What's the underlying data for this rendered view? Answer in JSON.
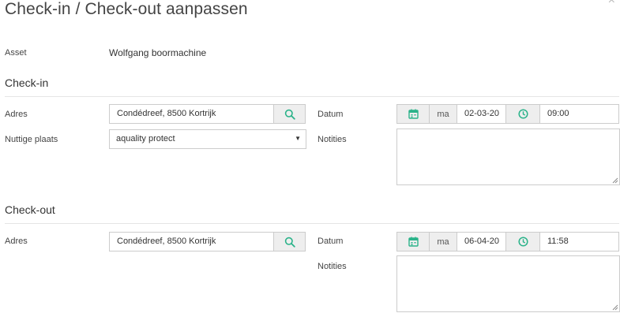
{
  "modal": {
    "title": "Check-in / Check-out aanpassen",
    "close_icon": "close-icon",
    "asset_label": "Asset",
    "asset_value": "Wolfgang boormachine"
  },
  "checkin": {
    "heading": "Check-in",
    "address_label": "Adres",
    "address_value": "Condédreef, 8500 Kortrijk",
    "place_label": "Nuttige plaats",
    "place_value": "aquality protect",
    "date_label": "Datum",
    "day": "ma",
    "date_value": "02-03-20",
    "time_value": "09:00",
    "notes_label": "Notities"
  },
  "checkout": {
    "heading": "Check-out",
    "address_label": "Adres",
    "address_value": "Condédreef, 8500 Kortrijk",
    "date_label": "Datum",
    "day": "ma",
    "date_value": "06-04-20",
    "time_value": "11:58",
    "notes_label": "Notities"
  },
  "colors": {
    "accent": "#2bb38a",
    "addon_bg": "#eeeeee",
    "border": "#cccccc"
  },
  "icons": {
    "search": "search-icon",
    "calendar": "calendar-icon",
    "clock": "clock-icon",
    "caret": "caret-down-icon",
    "resize": "resize-grip-icon"
  }
}
